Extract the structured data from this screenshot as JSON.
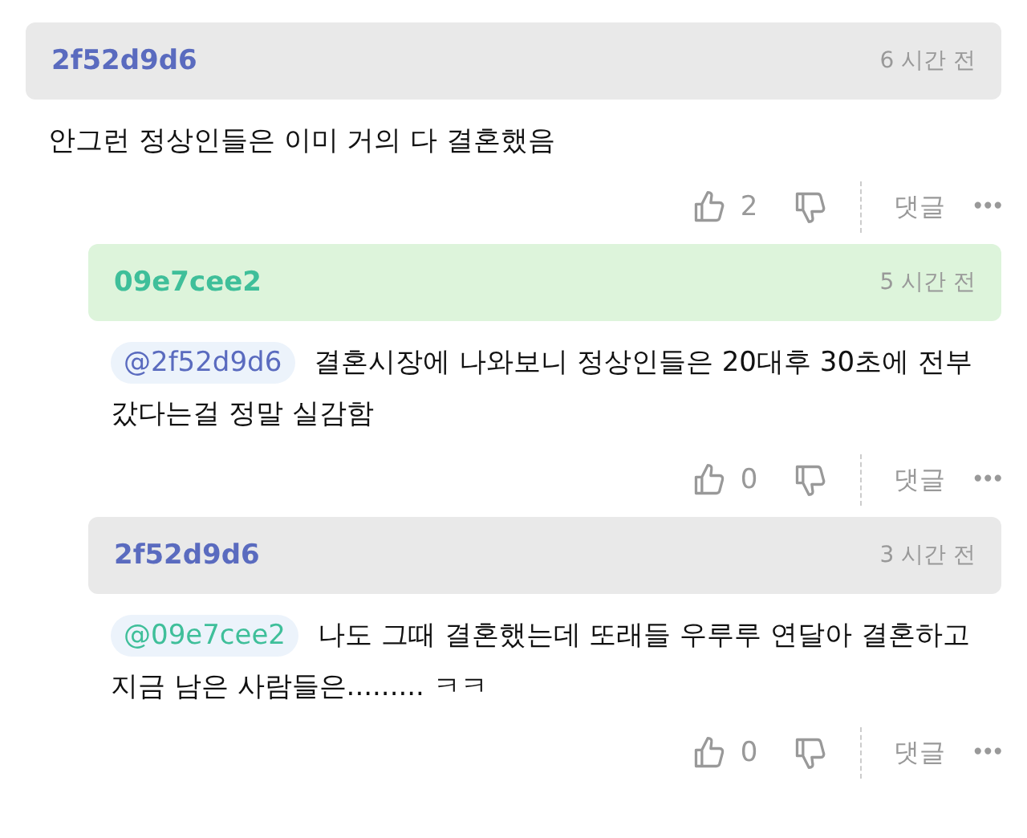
{
  "comments": [
    {
      "author": "2f52d9d6",
      "color": "#5a6bbf",
      "highlighted": false,
      "reply": false,
      "time": "6 시간 전",
      "text": "안그런 정상인들은 이미 거의 다 결혼했음",
      "likes": "2",
      "reply_label": "댓글",
      "more": "•••"
    },
    {
      "author": "09e7cee2",
      "color": "#3fbf9a",
      "highlighted": true,
      "reply": true,
      "time": "5 시간 전",
      "mention": {
        "text": "@2f52d9d6",
        "color": "#5a6bbf"
      },
      "text": "결혼시장에 나와보니 정상인들은 20대후 30초에 전부 갔다는걸 정말 실감함",
      "likes": "0",
      "reply_label": "댓글",
      "more": "•••"
    },
    {
      "author": "2f52d9d6",
      "color": "#5a6bbf",
      "highlighted": false,
      "reply": true,
      "time": "3 시간 전",
      "mention": {
        "text": "@09e7cee2",
        "color": "#3fbf9a"
      },
      "text": "나도 그때 결혼했는데 또래들 우루루 연달아 결혼하고 지금 남은 사람들은......... ㅋㅋ",
      "likes": "0",
      "reply_label": "댓글",
      "more": "•••"
    }
  ]
}
